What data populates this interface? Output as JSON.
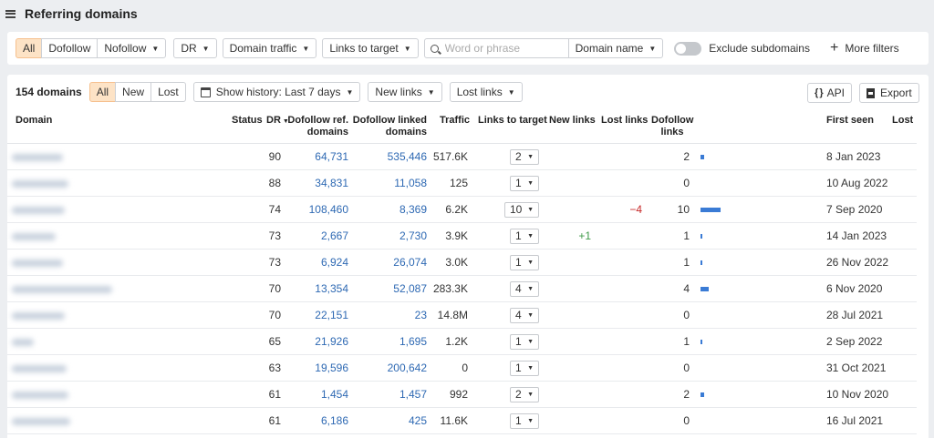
{
  "header": {
    "title": "Referring domains"
  },
  "filters": {
    "type_all": "All",
    "type_dofollow": "Dofollow",
    "type_nofollow": "Nofollow",
    "dr": "DR",
    "domain_traffic": "Domain traffic",
    "links_to_target": "Links to target",
    "search_placeholder": "Word or phrase",
    "search_scope": "Domain name",
    "exclude_subdomains": "Exclude subdomains",
    "more_filters": "More filters"
  },
  "toolbar": {
    "count": "154 domains",
    "tab_all": "All",
    "tab_new": "New",
    "tab_lost": "Lost",
    "history": "Show history: Last 7 days",
    "new_links": "New links",
    "lost_links": "Lost links",
    "api": "API",
    "export": "Export"
  },
  "columns": {
    "domain": "Domain",
    "status": "Status",
    "dr": "DR",
    "dofollow_ref_1": "Dofollow ref.",
    "dofollow_ref_2": "domains",
    "dofollow_linked_1": "Dofollow linked",
    "dofollow_linked_2": "domains",
    "traffic": "Traffic",
    "links_to_target": "Links to target",
    "new_links": "New links",
    "lost_links": "Lost links",
    "dofollow_links_1": "Dofollow",
    "dofollow_links_2": "links",
    "first_seen": "First seen",
    "lost": "Lost"
  },
  "rows": [
    {
      "dr": "90",
      "ref": "64,731",
      "linked": "535,446",
      "traffic": "517.6K",
      "ltt": "2",
      "new": "",
      "lost": "",
      "df": "2",
      "df_value": 2,
      "first_seen": "8 Jan 2023"
    },
    {
      "dr": "88",
      "ref": "34,831",
      "linked": "11,058",
      "traffic": "125",
      "ltt": "1",
      "new": "",
      "lost": "",
      "df": "0",
      "df_value": 0,
      "first_seen": "10 Aug 2022"
    },
    {
      "dr": "74",
      "ref": "108,460",
      "linked": "8,369",
      "traffic": "6.2K",
      "ltt": "10",
      "new": "",
      "lost": "−4",
      "df": "10",
      "df_value": 10,
      "first_seen": "7 Sep 2020"
    },
    {
      "dr": "73",
      "ref": "2,667",
      "linked": "2,730",
      "traffic": "3.9K",
      "ltt": "1",
      "new": "+1",
      "lost": "",
      "df": "1",
      "df_value": 1,
      "first_seen": "14 Jan 2023"
    },
    {
      "dr": "73",
      "ref": "6,924",
      "linked": "26,074",
      "traffic": "3.0K",
      "ltt": "1",
      "new": "",
      "lost": "",
      "df": "1",
      "df_value": 1,
      "first_seen": "26 Nov 2022"
    },
    {
      "dr": "70",
      "ref": "13,354",
      "linked": "52,087",
      "traffic": "283.3K",
      "ltt": "4",
      "new": "",
      "lost": "",
      "df": "4",
      "df_value": 4,
      "first_seen": "6 Nov 2020"
    },
    {
      "dr": "70",
      "ref": "22,151",
      "linked": "23",
      "traffic": "14.8M",
      "ltt": "4",
      "new": "",
      "lost": "",
      "df": "0",
      "df_value": 0,
      "first_seen": "28 Jul 2021"
    },
    {
      "dr": "65",
      "ref": "21,926",
      "linked": "1,695",
      "traffic": "1.2K",
      "ltt": "1",
      "new": "",
      "lost": "",
      "df": "1",
      "df_value": 1,
      "first_seen": "2 Sep 2022"
    },
    {
      "dr": "63",
      "ref": "19,596",
      "linked": "200,642",
      "traffic": "0",
      "ltt": "1",
      "new": "",
      "lost": "",
      "df": "0",
      "df_value": 0,
      "first_seen": "31 Oct 2021"
    },
    {
      "dr": "61",
      "ref": "1,454",
      "linked": "1,457",
      "traffic": "992",
      "ltt": "2",
      "new": "",
      "lost": "",
      "df": "2",
      "df_value": 2,
      "first_seen": "10 Nov 2020"
    },
    {
      "dr": "61",
      "ref": "6,186",
      "linked": "425",
      "traffic": "11.6K",
      "ltt": "1",
      "new": "",
      "lost": "",
      "df": "0",
      "df_value": 0,
      "first_seen": "16 Jul 2021"
    }
  ],
  "colors": {
    "accent_bg": "#fde3c6",
    "link": "#2e69b3",
    "positive": "#3f9a48",
    "negative": "#c62828",
    "bar": "#3a7bd5"
  }
}
